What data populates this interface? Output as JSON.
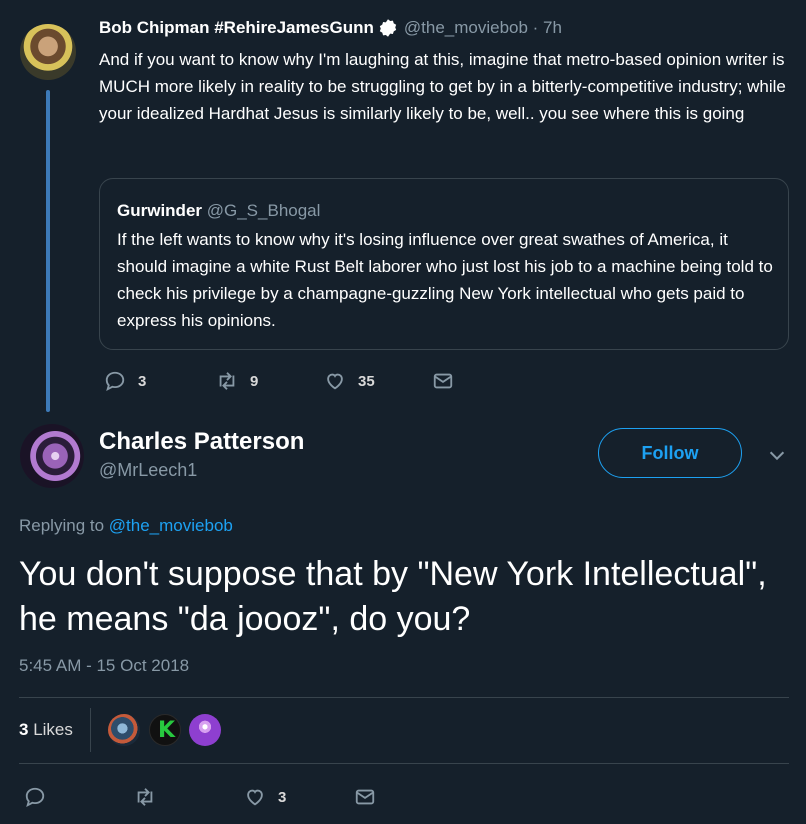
{
  "parent_tweet": {
    "name": "Bob Chipman #RehireJamesGunn",
    "handle_time": "@the_moviebob · 7h",
    "text": "And if you want to know why I'm laughing at this, imagine that metro-based opinion writer is MUCH more likely in reality to be struggling to get by in a bitterly-competitive industry; while your idealized Hardhat Jesus is similarly likely to be, well.. you see where this is going",
    "quote": {
      "name": "Gurwinder",
      "handle": "@G_S_Bhogal",
      "text": "If the left wants to know why it's losing influence over great swathes of America, it should imagine a white Rust Belt laborer who just lost his job to a machine being told to check his privilege by a champagne-guzzling New York intellectual who gets paid to express his opinions."
    },
    "actions": {
      "replies": "3",
      "retweets": "9",
      "likes": "35"
    }
  },
  "main_tweet": {
    "name": "Charles Patterson",
    "handle": "@MrLeech1",
    "follow_label": "Follow",
    "replying_prefix": "Replying to",
    "replying_to": "@the_moviebob",
    "text": "You don't suppose that by \"New York Intellectual\", he means \"da joooz\", do you?",
    "timestamp": "5:45 AM - 15 Oct 2018",
    "likes_count": "3",
    "likes_label": "Likes",
    "actions": {
      "likes": "3"
    }
  },
  "colors": {
    "background": "#15202b",
    "accent": "#1da1f2",
    "muted": "#8899a6",
    "border": "#38444d"
  },
  "icons": [
    "verified-icon",
    "reply-icon",
    "retweet-icon",
    "like-icon",
    "message-icon",
    "chevron-down-icon"
  ]
}
